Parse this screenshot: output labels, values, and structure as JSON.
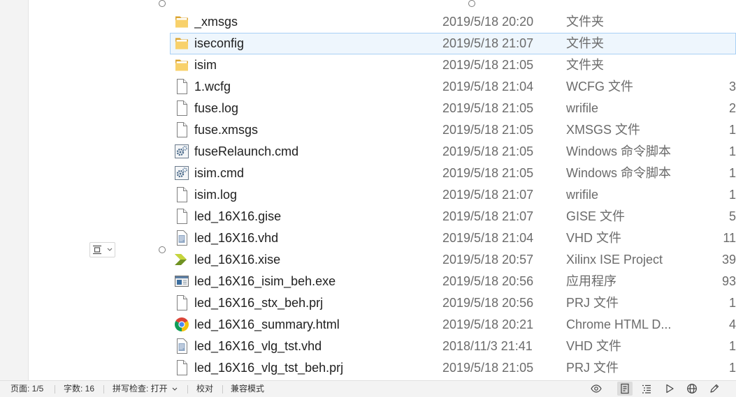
{
  "file_list": {
    "rows": [
      {
        "icon": "folder-icon",
        "name": "_xmsgs",
        "date": "2019/5/18 20:20",
        "type": "文件夹"
      },
      {
        "icon": "folder-icon",
        "name": "iseconfig",
        "date": "2019/5/18 21:07",
        "type": "文件夹",
        "selected": true
      },
      {
        "icon": "folder-icon",
        "name": "isim",
        "date": "2019/5/18 21:05",
        "type": "文件夹"
      },
      {
        "icon": "file-icon",
        "name": "1.wcfg",
        "date": "2019/5/18 21:04",
        "type": "WCFG 文件",
        "size": "3"
      },
      {
        "icon": "file-icon",
        "name": "fuse.log",
        "date": "2019/5/18 21:05",
        "type": "wrifile",
        "size": "2"
      },
      {
        "icon": "file-icon",
        "name": "fuse.xmsgs",
        "date": "2019/5/18 21:05",
        "type": "XMSGS 文件",
        "size": "1"
      },
      {
        "icon": "cmd-script-icon",
        "name": "fuseRelaunch.cmd",
        "date": "2019/5/18 21:05",
        "type": "Windows 命令脚本",
        "size": "1"
      },
      {
        "icon": "cmd-script-icon",
        "name": "isim.cmd",
        "date": "2019/5/18 21:05",
        "type": "Windows 命令脚本",
        "size": "1"
      },
      {
        "icon": "file-icon",
        "name": "isim.log",
        "date": "2019/5/18 21:07",
        "type": "wrifile",
        "size": "1"
      },
      {
        "icon": "file-icon",
        "name": "led_16X16.gise",
        "date": "2019/5/18 21:07",
        "type": "GISE 文件",
        "size": "5"
      },
      {
        "icon": "vhd-file-icon",
        "name": "led_16X16.vhd",
        "date": "2019/5/18 21:04",
        "type": "VHD 文件",
        "size": "11"
      },
      {
        "icon": "xilinx-project-icon",
        "name": "led_16X16.xise",
        "date": "2019/5/18 20:57",
        "type": "Xilinx ISE Project",
        "size": "39"
      },
      {
        "icon": "exe-app-icon",
        "name": "led_16X16_isim_beh.exe",
        "date": "2019/5/18 20:56",
        "type": "应用程序",
        "size": "93"
      },
      {
        "icon": "file-icon",
        "name": "led_16X16_stx_beh.prj",
        "date": "2019/5/18 20:56",
        "type": "PRJ 文件",
        "size": "1"
      },
      {
        "icon": "chrome-icon",
        "name": "led_16X16_summary.html",
        "date": "2019/5/18 20:21",
        "type": "Chrome HTML D...",
        "size": "4"
      },
      {
        "icon": "vhd-file-icon",
        "name": "led_16X16_vlg_tst.vhd",
        "date": "2018/11/3 21:41",
        "type": "VHD 文件",
        "size": "1"
      },
      {
        "icon": "file-icon",
        "name": "led_16X16_vlg_tst_beh.prj",
        "date": "2019/5/18 21:05",
        "type": "PRJ 文件",
        "size": "1"
      }
    ]
  },
  "layout_options_button": {
    "icon": "layout-options-icon"
  },
  "status_bar": {
    "page": "页面: 1/5",
    "word_count": "字数: 16",
    "spell_check": "拼写检查: 打开",
    "proofread": "校对",
    "compat_mode": "兼容模式",
    "view_icons": [
      "eye-icon",
      "page-view-icon",
      "outline-icon",
      "play-icon",
      "globe-icon",
      "pen-icon"
    ],
    "active_view": "page-view-icon"
  },
  "colors": {
    "selection_fill": "#eef6fd",
    "selection_border": "#a9d0f5",
    "status_bar_bg": "#f3f3f3",
    "name_text": "#1f1f1f",
    "meta_text": "#6b6b6b",
    "folder": "#f8d16b"
  }
}
